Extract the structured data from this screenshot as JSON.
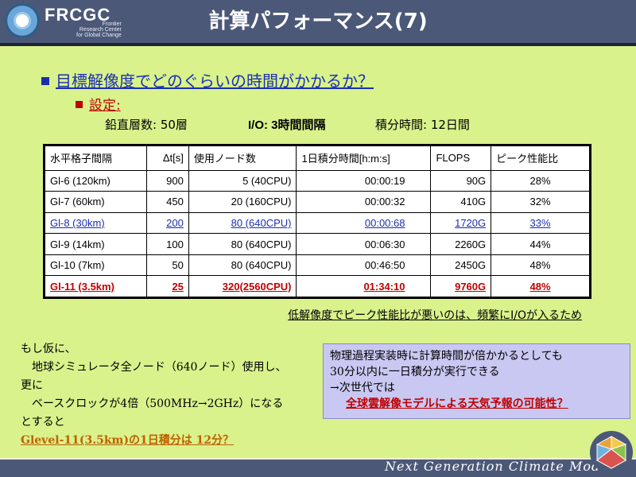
{
  "header": {
    "brand": "FRCGC",
    "brand_sub_1": "Frontier",
    "brand_sub_2": "Research Center",
    "brand_sub_3": "for Global Change",
    "title": "計算パフォーマンス(7)"
  },
  "question": "目標解像度でどのぐらいの時間がかかるか？",
  "settings_label": "設定:",
  "params": {
    "layers": "鉛直層数:  50層",
    "io": "I/O:   3時間間隔",
    "integration": "積分時間:   12日間"
  },
  "table": {
    "headers": [
      "水平格子間隔",
      "Δt[s]",
      "使用ノード数",
      "1日積分時間[h:m:s]",
      "FLOPS",
      "ピーク性能比"
    ],
    "rows": [
      [
        "Gl-6 (120km)",
        "900",
        "5 (40CPU)",
        "00:00:19",
        "90G",
        "28%"
      ],
      [
        "Gl-7 (60km)",
        "450",
        "20 (160CPU)",
        "00:00:32",
        "410G",
        "32%"
      ],
      [
        "Gl-8 (30km)",
        "200",
        "80 (640CPU)",
        "00:00:68",
        "1720G",
        "33%"
      ],
      [
        "Gl-9 (14km)",
        "100",
        "80 (640CPU)",
        "00:06:30",
        "2260G",
        "44%"
      ],
      [
        "Gl-10 (7km)",
        "50",
        "80 (640CPU)",
        "00:46:50",
        "2450G",
        "48%"
      ],
      [
        "Gl-11 (3.5km)",
        "25",
        "320(2560CPU)",
        "01:34:10",
        "9760G",
        "48%"
      ]
    ]
  },
  "note": "低解像度でピーク性能比が悪いのは、頻繁にI/Oが入るため",
  "left_note": {
    "line1": "もし仮に、",
    "line2": "地球シミュレータ全ノード（640ノード）使用し、",
    "line3": "更に",
    "line4": "ベースクロックが4倍（500MHz→2GHz）になる",
    "line5": "とすると",
    "line6": "Glevel-11(3.5km)の1日積分は 12分？"
  },
  "box": {
    "line1": "物理過程実装時に計算時間が倍かかるとしても",
    "line2": "30分以内に一日積分が実行できる",
    "line3": "→次世代では",
    "line4": "全球雲解像モデルによる天気予報の可能性？"
  },
  "footer": "Next Generation Climate Model",
  "colors": {
    "header_bg": "#4b5878",
    "slide_bg": "#d9f28c",
    "accent_blue": "#1a2fb0",
    "accent_red": "#c00000",
    "box_bg": "#c9c8f2"
  }
}
